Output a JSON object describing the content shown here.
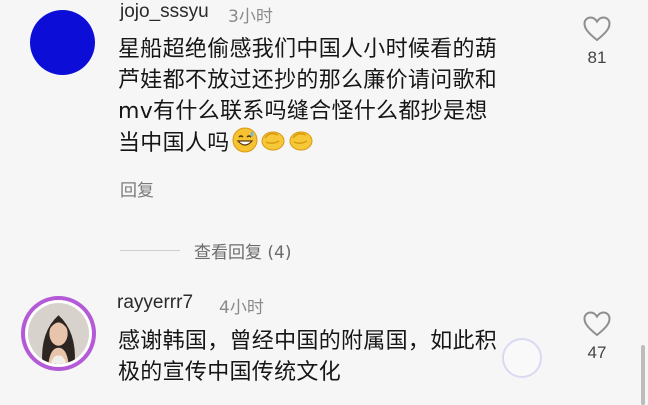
{
  "comments": [
    {
      "username": "jojo_sssyu",
      "time": "3小时",
      "lines": [
        "星船超绝偷感我们中国人小时候看的葫",
        "芦娃都不放过还抄的那么廉价请问歌和",
        "mv有什么联系吗缝合怪什么都抄是想",
        "当中国人吗"
      ],
      "emojis": [
        "grinning-sweat-face-emoji",
        "pinching-hand-emoji",
        "pinching-hand-emoji"
      ],
      "likes": "81",
      "reply_label": "回复",
      "view_replies_label": "查看回复 (4)",
      "avatar_color": "#0c0ed8"
    },
    {
      "username": "rayyerrr7",
      "time": "4小时",
      "lines": [
        "感谢韩国，曾经中国的附属国，如此积",
        "极的宣传中国传统文化"
      ],
      "likes": "47",
      "avatar_ring_color": "#b45ad6"
    }
  ],
  "icons": {
    "like": "heart-outline-icon"
  }
}
